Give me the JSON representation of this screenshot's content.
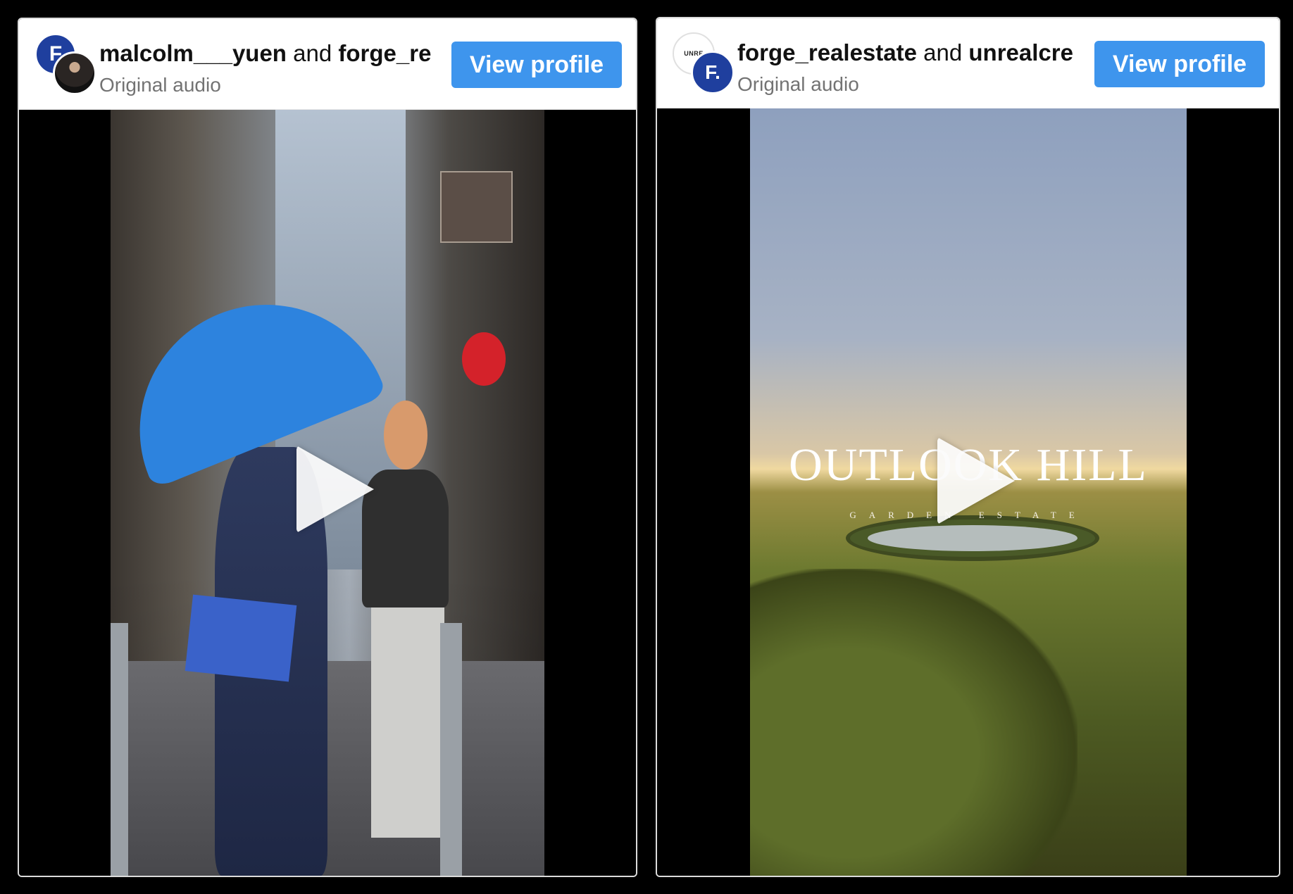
{
  "posts": [
    {
      "collaborators": [
        "malcolm___yuen",
        "forge_re"
      ],
      "joiner": "and",
      "audio": "Original audio",
      "button_label": "View profile",
      "avatar_back_glyph": "F",
      "avatar_back_color": "#1f3f9e"
    },
    {
      "collaborators": [
        "forge_realestate",
        "unrealcre"
      ],
      "joiner": "and",
      "audio": "Original audio",
      "button_label": "View profile",
      "avatar_back_glyph": "UNRE",
      "avatar_front_glyph": "F.",
      "avatar_front_color": "#1f3f9e",
      "video_title": "OUTLOOK HILL",
      "video_subtitle": "GARDEN ESTATE"
    }
  ],
  "colors": {
    "button": "#3e95ed",
    "background": "#000000",
    "secondary_text": "#737373"
  },
  "icons": [
    "play-icon"
  ]
}
